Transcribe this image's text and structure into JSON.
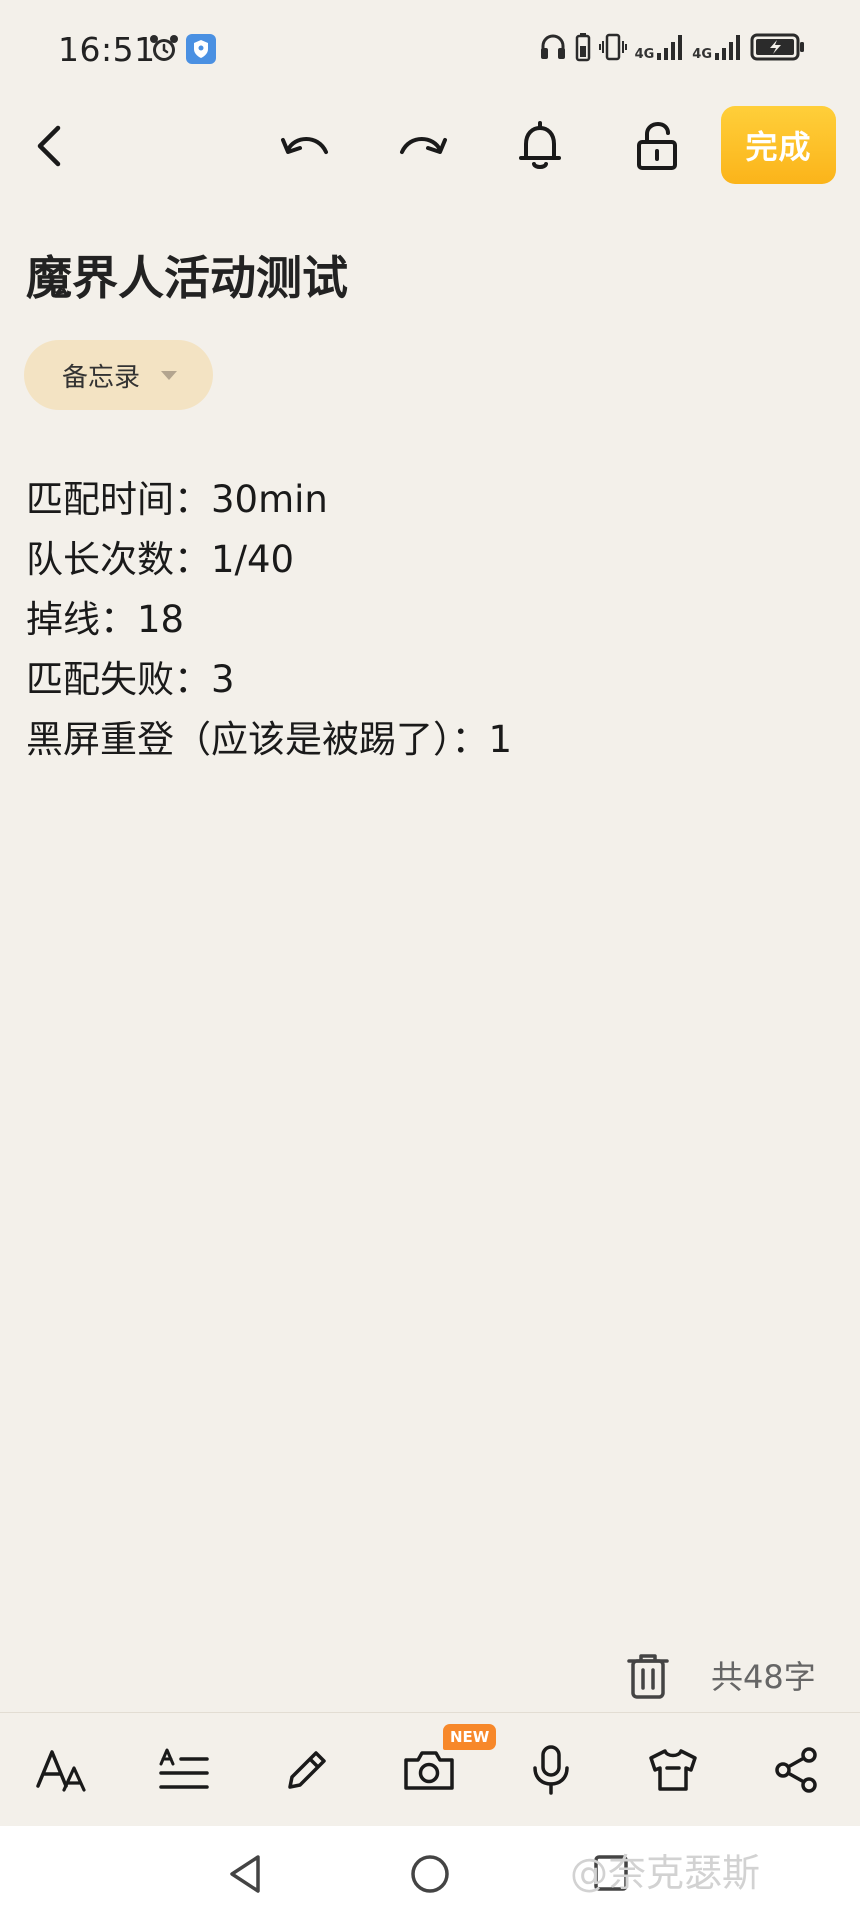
{
  "status_bar": {
    "time": "16:51",
    "network_1": "4G",
    "network_2": "4G",
    "icons": [
      "alarm-icon",
      "vpn-icon",
      "headphones-icon",
      "battery-small-icon",
      "vibrate-icon",
      "signal-icon",
      "signal-icon",
      "battery-charging-icon"
    ]
  },
  "toolbar": {
    "done_label": "完成",
    "icons": [
      "back-icon",
      "undo-icon",
      "redo-icon",
      "bell-icon",
      "unlock-icon"
    ]
  },
  "note": {
    "title": "魔界人活动测试",
    "category": "备忘录",
    "lines": [
      "匹配时间：30min",
      "队长次数：1/40",
      "掉线：18",
      "匹配失败：3",
      "黑屏重登（应该是被踢了）：1"
    ],
    "word_count": "共48字"
  },
  "bottom_toolbar": {
    "new_badge": "NEW",
    "icons": [
      "text-style-icon",
      "list-format-icon",
      "pencil-icon",
      "camera-icon",
      "microphone-icon",
      "shirt-icon",
      "share-icon"
    ]
  },
  "watermark": "@奈克瑟斯",
  "colors": {
    "background": "#f3f0ea",
    "accent": "#fbb41a",
    "chip": "#f3e3c3",
    "badge": "#f7882a"
  }
}
